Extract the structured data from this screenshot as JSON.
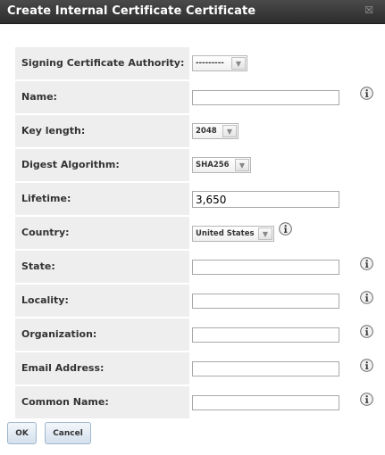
{
  "dialog": {
    "title": "Create Internal Certificate Certificate",
    "close_icon": "close-icon"
  },
  "form": {
    "rows": [
      {
        "label": "Signing Certificate Authority:",
        "type": "select",
        "value": "---------",
        "info": false
      },
      {
        "label": "Name:",
        "type": "text",
        "value": "",
        "info": true
      },
      {
        "label": "Key length:",
        "type": "select",
        "value": "2048",
        "info": false
      },
      {
        "label": "Digest Algorithm:",
        "type": "select",
        "value": "SHA256",
        "info": false
      },
      {
        "label": "Lifetime:",
        "type": "text",
        "value": "3,650",
        "info": false
      },
      {
        "label": "Country:",
        "type": "select",
        "value": "United States",
        "info": true
      },
      {
        "label": "State:",
        "type": "text",
        "value": "",
        "info": true
      },
      {
        "label": "Locality:",
        "type": "text",
        "value": "",
        "info": true
      },
      {
        "label": "Organization:",
        "type": "text",
        "value": "",
        "info": true
      },
      {
        "label": "Email Address:",
        "type": "text",
        "value": "",
        "info": true
      },
      {
        "label": "Common Name:",
        "type": "text",
        "value": "",
        "info": true
      }
    ]
  },
  "buttons": {
    "ok_label": "OK",
    "cancel_label": "Cancel"
  },
  "colors": {
    "titlebar": "#333333",
    "label_background": "#eeeeee",
    "button_border": "#9fb7cf"
  }
}
